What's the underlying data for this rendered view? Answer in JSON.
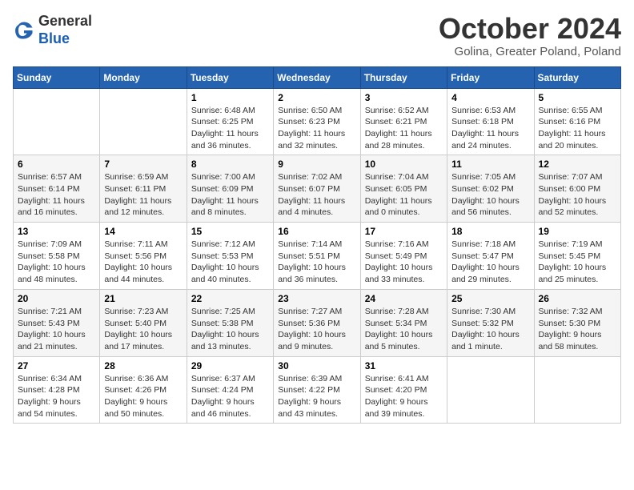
{
  "logo": {
    "general": "General",
    "blue": "Blue"
  },
  "header": {
    "title": "October 2024",
    "location": "Golina, Greater Poland, Poland"
  },
  "weekdays": [
    "Sunday",
    "Monday",
    "Tuesday",
    "Wednesday",
    "Thursday",
    "Friday",
    "Saturday"
  ],
  "weeks": [
    [
      {
        "day": "",
        "sunrise": "",
        "sunset": "",
        "daylight": ""
      },
      {
        "day": "",
        "sunrise": "",
        "sunset": "",
        "daylight": ""
      },
      {
        "day": "1",
        "sunrise": "Sunrise: 6:48 AM",
        "sunset": "Sunset: 6:25 PM",
        "daylight": "Daylight: 11 hours and 36 minutes."
      },
      {
        "day": "2",
        "sunrise": "Sunrise: 6:50 AM",
        "sunset": "Sunset: 6:23 PM",
        "daylight": "Daylight: 11 hours and 32 minutes."
      },
      {
        "day": "3",
        "sunrise": "Sunrise: 6:52 AM",
        "sunset": "Sunset: 6:21 PM",
        "daylight": "Daylight: 11 hours and 28 minutes."
      },
      {
        "day": "4",
        "sunrise": "Sunrise: 6:53 AM",
        "sunset": "Sunset: 6:18 PM",
        "daylight": "Daylight: 11 hours and 24 minutes."
      },
      {
        "day": "5",
        "sunrise": "Sunrise: 6:55 AM",
        "sunset": "Sunset: 6:16 PM",
        "daylight": "Daylight: 11 hours and 20 minutes."
      }
    ],
    [
      {
        "day": "6",
        "sunrise": "Sunrise: 6:57 AM",
        "sunset": "Sunset: 6:14 PM",
        "daylight": "Daylight: 11 hours and 16 minutes."
      },
      {
        "day": "7",
        "sunrise": "Sunrise: 6:59 AM",
        "sunset": "Sunset: 6:11 PM",
        "daylight": "Daylight: 11 hours and 12 minutes."
      },
      {
        "day": "8",
        "sunrise": "Sunrise: 7:00 AM",
        "sunset": "Sunset: 6:09 PM",
        "daylight": "Daylight: 11 hours and 8 minutes."
      },
      {
        "day": "9",
        "sunrise": "Sunrise: 7:02 AM",
        "sunset": "Sunset: 6:07 PM",
        "daylight": "Daylight: 11 hours and 4 minutes."
      },
      {
        "day": "10",
        "sunrise": "Sunrise: 7:04 AM",
        "sunset": "Sunset: 6:05 PM",
        "daylight": "Daylight: 11 hours and 0 minutes."
      },
      {
        "day": "11",
        "sunrise": "Sunrise: 7:05 AM",
        "sunset": "Sunset: 6:02 PM",
        "daylight": "Daylight: 10 hours and 56 minutes."
      },
      {
        "day": "12",
        "sunrise": "Sunrise: 7:07 AM",
        "sunset": "Sunset: 6:00 PM",
        "daylight": "Daylight: 10 hours and 52 minutes."
      }
    ],
    [
      {
        "day": "13",
        "sunrise": "Sunrise: 7:09 AM",
        "sunset": "Sunset: 5:58 PM",
        "daylight": "Daylight: 10 hours and 48 minutes."
      },
      {
        "day": "14",
        "sunrise": "Sunrise: 7:11 AM",
        "sunset": "Sunset: 5:56 PM",
        "daylight": "Daylight: 10 hours and 44 minutes."
      },
      {
        "day": "15",
        "sunrise": "Sunrise: 7:12 AM",
        "sunset": "Sunset: 5:53 PM",
        "daylight": "Daylight: 10 hours and 40 minutes."
      },
      {
        "day": "16",
        "sunrise": "Sunrise: 7:14 AM",
        "sunset": "Sunset: 5:51 PM",
        "daylight": "Daylight: 10 hours and 36 minutes."
      },
      {
        "day": "17",
        "sunrise": "Sunrise: 7:16 AM",
        "sunset": "Sunset: 5:49 PM",
        "daylight": "Daylight: 10 hours and 33 minutes."
      },
      {
        "day": "18",
        "sunrise": "Sunrise: 7:18 AM",
        "sunset": "Sunset: 5:47 PM",
        "daylight": "Daylight: 10 hours and 29 minutes."
      },
      {
        "day": "19",
        "sunrise": "Sunrise: 7:19 AM",
        "sunset": "Sunset: 5:45 PM",
        "daylight": "Daylight: 10 hours and 25 minutes."
      }
    ],
    [
      {
        "day": "20",
        "sunrise": "Sunrise: 7:21 AM",
        "sunset": "Sunset: 5:43 PM",
        "daylight": "Daylight: 10 hours and 21 minutes."
      },
      {
        "day": "21",
        "sunrise": "Sunrise: 7:23 AM",
        "sunset": "Sunset: 5:40 PM",
        "daylight": "Daylight: 10 hours and 17 minutes."
      },
      {
        "day": "22",
        "sunrise": "Sunrise: 7:25 AM",
        "sunset": "Sunset: 5:38 PM",
        "daylight": "Daylight: 10 hours and 13 minutes."
      },
      {
        "day": "23",
        "sunrise": "Sunrise: 7:27 AM",
        "sunset": "Sunset: 5:36 PM",
        "daylight": "Daylight: 10 hours and 9 minutes."
      },
      {
        "day": "24",
        "sunrise": "Sunrise: 7:28 AM",
        "sunset": "Sunset: 5:34 PM",
        "daylight": "Daylight: 10 hours and 5 minutes."
      },
      {
        "day": "25",
        "sunrise": "Sunrise: 7:30 AM",
        "sunset": "Sunset: 5:32 PM",
        "daylight": "Daylight: 10 hours and 1 minute."
      },
      {
        "day": "26",
        "sunrise": "Sunrise: 7:32 AM",
        "sunset": "Sunset: 5:30 PM",
        "daylight": "Daylight: 9 hours and 58 minutes."
      }
    ],
    [
      {
        "day": "27",
        "sunrise": "Sunrise: 6:34 AM",
        "sunset": "Sunset: 4:28 PM",
        "daylight": "Daylight: 9 hours and 54 minutes."
      },
      {
        "day": "28",
        "sunrise": "Sunrise: 6:36 AM",
        "sunset": "Sunset: 4:26 PM",
        "daylight": "Daylight: 9 hours and 50 minutes."
      },
      {
        "day": "29",
        "sunrise": "Sunrise: 6:37 AM",
        "sunset": "Sunset: 4:24 PM",
        "daylight": "Daylight: 9 hours and 46 minutes."
      },
      {
        "day": "30",
        "sunrise": "Sunrise: 6:39 AM",
        "sunset": "Sunset: 4:22 PM",
        "daylight": "Daylight: 9 hours and 43 minutes."
      },
      {
        "day": "31",
        "sunrise": "Sunrise: 6:41 AM",
        "sunset": "Sunset: 4:20 PM",
        "daylight": "Daylight: 9 hours and 39 minutes."
      },
      {
        "day": "",
        "sunrise": "",
        "sunset": "",
        "daylight": ""
      },
      {
        "day": "",
        "sunrise": "",
        "sunset": "",
        "daylight": ""
      }
    ]
  ]
}
